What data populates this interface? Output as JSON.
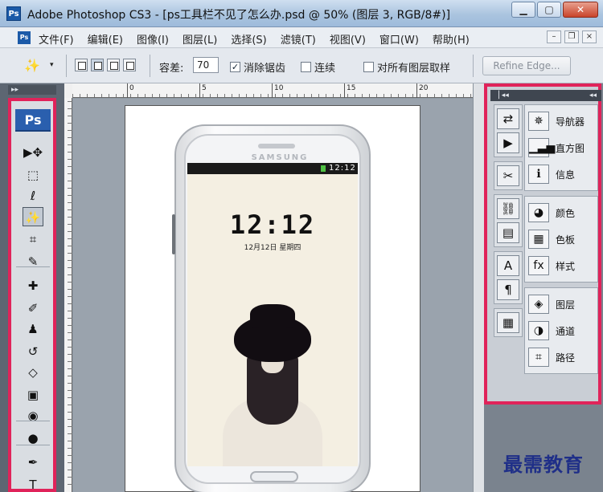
{
  "titlebar": {
    "icon": "Ps",
    "title": "Adobe Photoshop CS3 - [ps工具栏不见了怎么办.psd @ 50% (图层 3, RGB/8#)]",
    "minimize": "▁",
    "maximize": "▢",
    "close": "✕"
  },
  "menubar": {
    "icon": "Ps",
    "items": [
      "文件(F)",
      "编辑(E)",
      "图像(I)",
      "图层(L)",
      "选择(S)",
      "滤镜(T)",
      "视图(V)",
      "窗口(W)",
      "帮助(H)"
    ],
    "doc_minimize": "–",
    "doc_restore": "❐",
    "doc_close": "×"
  },
  "options": {
    "tool_glyph": "✨",
    "caret": "▾",
    "tolerance_label": "容差:",
    "tolerance_value": "70",
    "antialias_label": "消除锯齿",
    "antialias_checked": "✓",
    "contiguous_label": "连续",
    "all_layers_label": "对所有图层取样",
    "refine_label": "Refine Edge..."
  },
  "rulers": {
    "h_labels": [
      "0",
      "5",
      "10",
      "15",
      "20"
    ]
  },
  "toolbox": {
    "grip": "▸▸",
    "logo": "Ps",
    "tools": [
      {
        "name": "move-tool",
        "glyph": "▶✥"
      },
      {
        "name": "marquee-tool",
        "glyph": "⬚"
      },
      {
        "name": "lasso-tool",
        "glyph": "ℓ"
      },
      {
        "name": "magic-wand-tool",
        "glyph": "✨"
      },
      {
        "name": "crop-tool",
        "glyph": "⌗"
      },
      {
        "name": "slice-tool",
        "glyph": "✎"
      },
      {
        "name": "healing-brush-tool",
        "glyph": "✚"
      },
      {
        "name": "brush-tool",
        "glyph": "✐"
      },
      {
        "name": "clone-stamp-tool",
        "glyph": "♟"
      },
      {
        "name": "history-brush-tool",
        "glyph": "↺"
      },
      {
        "name": "eraser-tool",
        "glyph": "◇"
      },
      {
        "name": "gradient-tool",
        "glyph": "▣"
      },
      {
        "name": "blur-tool",
        "glyph": "◉"
      },
      {
        "name": "dodge-tool",
        "glyph": "●"
      },
      {
        "name": "pen-tool",
        "glyph": "✒"
      },
      {
        "name": "type-tool",
        "glyph": "T"
      }
    ]
  },
  "phone": {
    "brand": "SAMSUNG",
    "status_time": "12:12",
    "clock": "12:12",
    "date": "12月12日  星期四"
  },
  "dock": {
    "grip_left": "▕ ◂◂",
    "grip_right": "◂◂",
    "icon_groups": [
      [
        {
          "name": "history-icon",
          "glyph": "⇄"
        },
        {
          "name": "actions-icon",
          "glyph": "▶"
        }
      ],
      [
        {
          "name": "tool-presets-icon",
          "glyph": "✂"
        }
      ],
      [
        {
          "name": "clone-source-icon",
          "glyph": "⛓"
        },
        {
          "name": "layer-comps-icon",
          "glyph": "▤"
        }
      ],
      [
        {
          "name": "character-icon",
          "glyph": "A"
        },
        {
          "name": "paragraph-icon",
          "glyph": "¶"
        }
      ],
      [
        {
          "name": "notes-icon",
          "glyph": "▦"
        }
      ]
    ],
    "panel_groups": [
      [
        {
          "name": "navigator",
          "glyph": "✵",
          "label": "导航器"
        },
        {
          "name": "histogram",
          "glyph": "▁▃▅",
          "label": "直方图"
        },
        {
          "name": "info",
          "glyph": "ℹ",
          "label": "信息"
        }
      ],
      [
        {
          "name": "color",
          "glyph": "◕",
          "label": "颜色"
        },
        {
          "name": "swatches",
          "glyph": "▦",
          "label": "色板"
        },
        {
          "name": "styles",
          "glyph": "fx",
          "label": "样式"
        }
      ],
      [
        {
          "name": "layers",
          "glyph": "◈",
          "label": "图层"
        },
        {
          "name": "channels",
          "glyph": "◑",
          "label": "通道"
        },
        {
          "name": "paths",
          "glyph": "⌗",
          "label": "路径"
        }
      ]
    ]
  },
  "watermark": "最需教育",
  "colors": {
    "highlight_border": "#e0235a",
    "ps_blue": "#2a5fae"
  }
}
